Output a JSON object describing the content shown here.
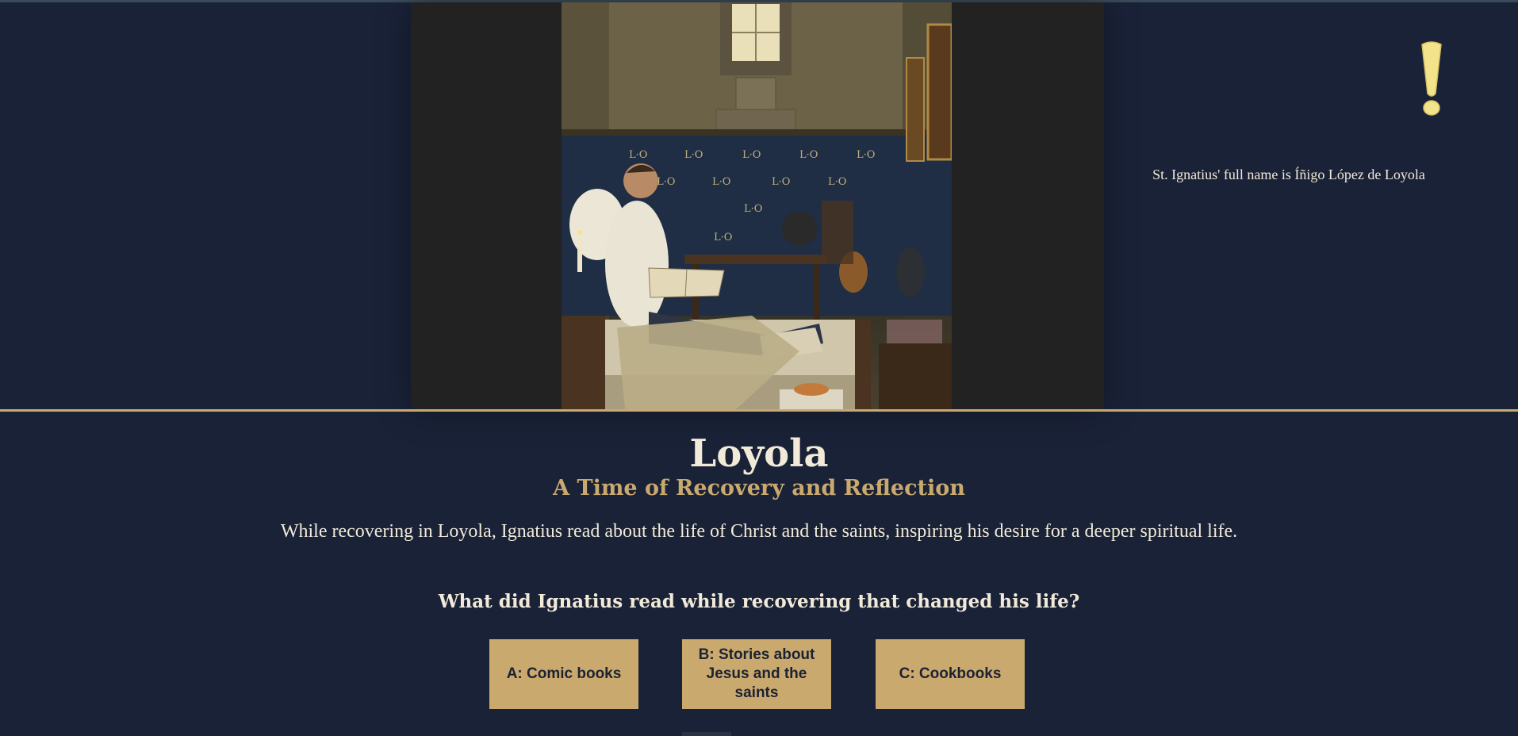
{
  "fact": {
    "icon": "exclamation-icon",
    "text": "St. Ignatius' full name is Íñigo López de Loyola"
  },
  "image": {
    "subject": "loyola-recovery-painting",
    "wall_text": "L·O"
  },
  "lesson": {
    "title": "Loyola",
    "subtitle": "A Time of Recovery and Reflection",
    "description": "While recovering in Loyola, Ignatius read about the life of Christ and the saints, inspiring his desire for a deeper spiritual life."
  },
  "quiz": {
    "question": "What did Ignatius read while recovering that changed his life?",
    "answers": [
      {
        "label": "A: Comic books"
      },
      {
        "label": "B: Stories about Jesus and the saints"
      },
      {
        "label": "C: Cookbooks"
      }
    ]
  },
  "colors": {
    "background": "#1a2238",
    "accent_gold": "#c9a96e",
    "text_light": "#f1ead8",
    "icon_yellow": "#f3e38a"
  }
}
